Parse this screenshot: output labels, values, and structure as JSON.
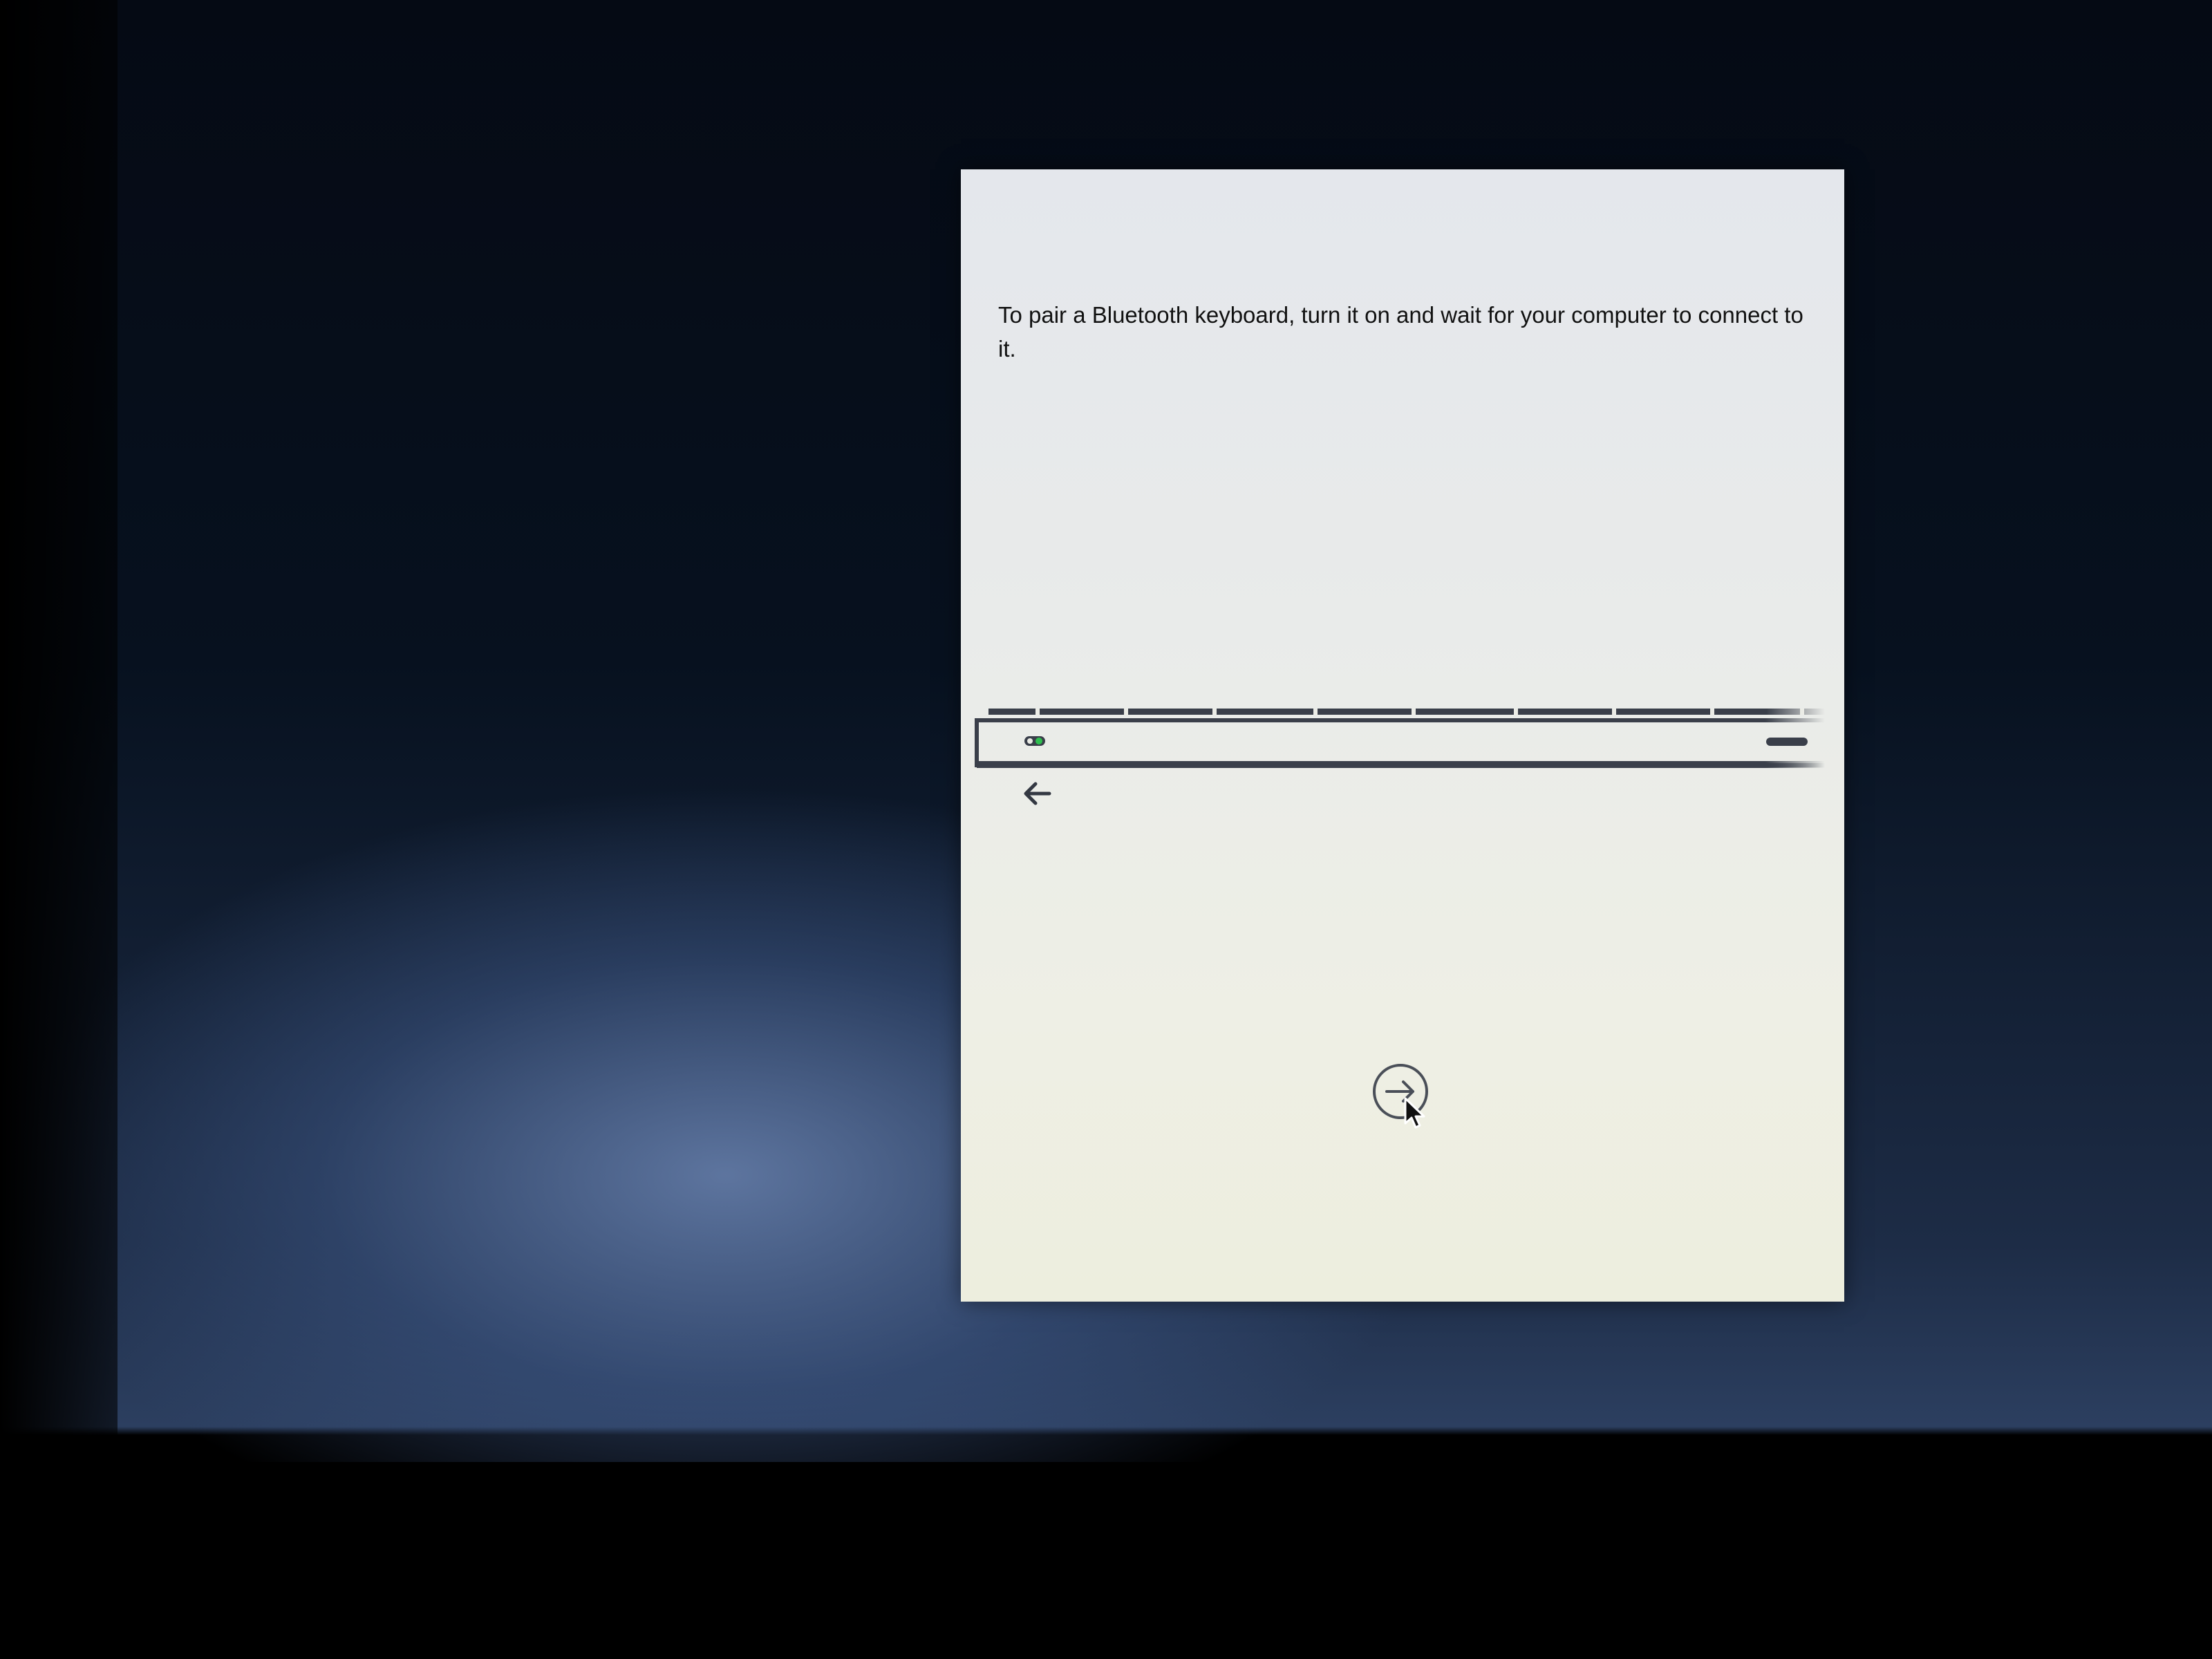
{
  "setup_assistant": {
    "instruction": "To pair a Bluetooth keyboard, turn it on and wait for your computer to connect to it.",
    "keyboard_illustration": {
      "icon": "bluetooth-keyboard-illustration",
      "power_indicator_color": "#2fbf4f"
    },
    "navigation": {
      "back_icon": "arrow-left-icon",
      "continue_icon": "arrow-right-circle-icon"
    }
  },
  "colors": {
    "panel_background": "#ebece6",
    "text": "#111111",
    "illustration_stroke": "#3a3f4a",
    "desktop_background": "#1d2c46"
  }
}
